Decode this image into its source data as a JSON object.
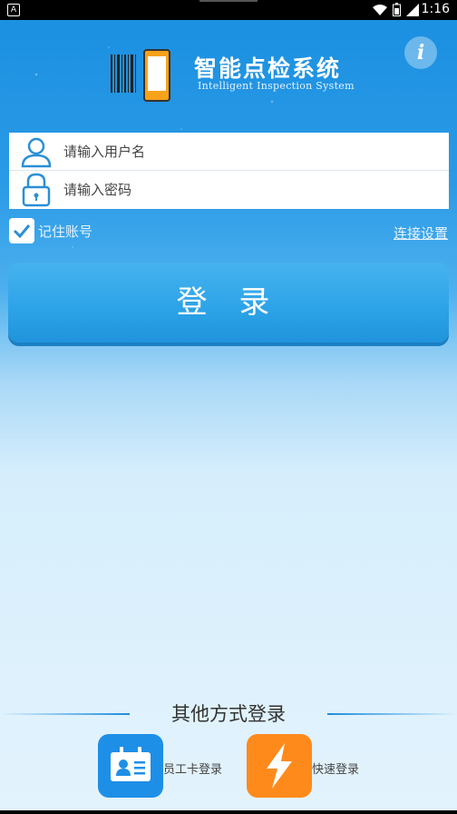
{
  "status_bar": {
    "time": "1:16"
  },
  "logo": {
    "title": "智能点检系统",
    "subtitle": "Intelligent Inspection System"
  },
  "form": {
    "username_placeholder": "请输入用户名",
    "password_placeholder": "请输入密码"
  },
  "remember": {
    "label": "记住账号",
    "checked": true
  },
  "connection_settings": "连接设置",
  "login_button": "登 录",
  "other_methods": {
    "title": "其他方式登录",
    "card_login": "员工卡登录",
    "quick_login": "快速登录"
  },
  "colors": {
    "accent": "#1e8fe6",
    "quick": "#ff8a1c"
  }
}
